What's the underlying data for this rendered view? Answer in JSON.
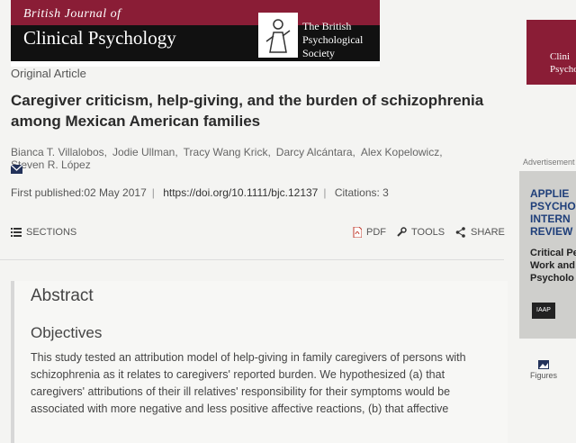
{
  "header": {
    "journal_small": "British Journal of",
    "journal_big": "Clinical Psychology",
    "society": "The British Psychological Society"
  },
  "article": {
    "type": "Original Article",
    "title": "Caregiver criticism, help-giving, and the burden of schizophrenia among Mexican American families",
    "authors": [
      "Bianca T. Villalobos,",
      "Jodie Ullman,",
      "Tracy Wang Krick,",
      "Darcy Alcántara,",
      "Alex Kopelowicz,",
      "Steven R. López"
    ],
    "first_published": "First published:02 May 2017",
    "doi": "https://doi.org/10.1111/bjc.12137",
    "citations": "Citations: 3"
  },
  "toolbar": {
    "sections": "SECTIONS",
    "pdf": "PDF",
    "tools": "TOOLS",
    "share": "SHARE"
  },
  "abstract": {
    "heading": "Abstract",
    "subheading": "Objectives",
    "text": "This study tested an attribution model of help-giving in family caregivers of persons with schizophrenia as it relates to caregivers' reported burden. We hypothesized (a) that caregivers' attributions of their ill relatives' responsibility for their symptoms would be associated with more negative and less positive affective reactions, (b) that affective"
  },
  "sidebar": {
    "cover_text": "Clini Psycho",
    "ad_label": "Advertisement",
    "ad_blue": "APPLIE PSYCHO INTERN REVIEW",
    "ad_black": "Critical Pe Work and Psycholo",
    "ad_logo": "IAAP",
    "figures": "Figures"
  },
  "colors": {
    "brand": "#8a1d36",
    "ad_blue": "#1f3f7a"
  }
}
